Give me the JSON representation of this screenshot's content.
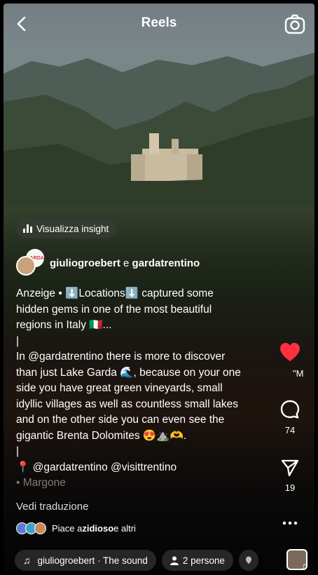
{
  "header": {
    "title": "Reels",
    "back_icon": "chevron-left-icon",
    "camera_icon": "camera-icon"
  },
  "insight_button": {
    "label": "Visualizza insight",
    "icon": "bar-chart-icon"
  },
  "authors": {
    "user1": "giuliogroebert",
    "connector": "e",
    "user2": "gardatrentino",
    "avatar2_text": "GARDA"
  },
  "caption": {
    "lines": [
      "Anzeige • ⬇️Locations⬇️ captured some",
      "hidden gems in one of the most beautiful",
      "regions in Italy 🇮🇹...",
      "|",
      "In @gardatrentino there is more to discover",
      "than just Lake Garda 🌊, because on your one",
      "side you have great green vineyards, small",
      "idyllic villages as well as countless small lakes",
      "and on the other side you can even see the",
      "gigantic Brenta Dolomites 😍⛰️🫶.",
      "|",
      "📍 @gardatrentino @visittrentino",
      "• Margone"
    ]
  },
  "translate_link": "Vedi traduzione",
  "likes": {
    "prefix": "Piace a ",
    "user": "zidioso",
    "suffix": " e altri"
  },
  "pills": {
    "audio": "giuliogroebert · The sound",
    "people": "2 persone"
  },
  "side_actions": {
    "like_icon": "heart-icon",
    "comment_icon": "comment-icon",
    "comments_count": "74",
    "share_icon": "paper-plane-icon",
    "shares_count": "19",
    "more_icon": "more-icon",
    "comment_preview": "\"M"
  },
  "colors": {
    "like_red": "#ff3040",
    "text": "#ffffff"
  }
}
